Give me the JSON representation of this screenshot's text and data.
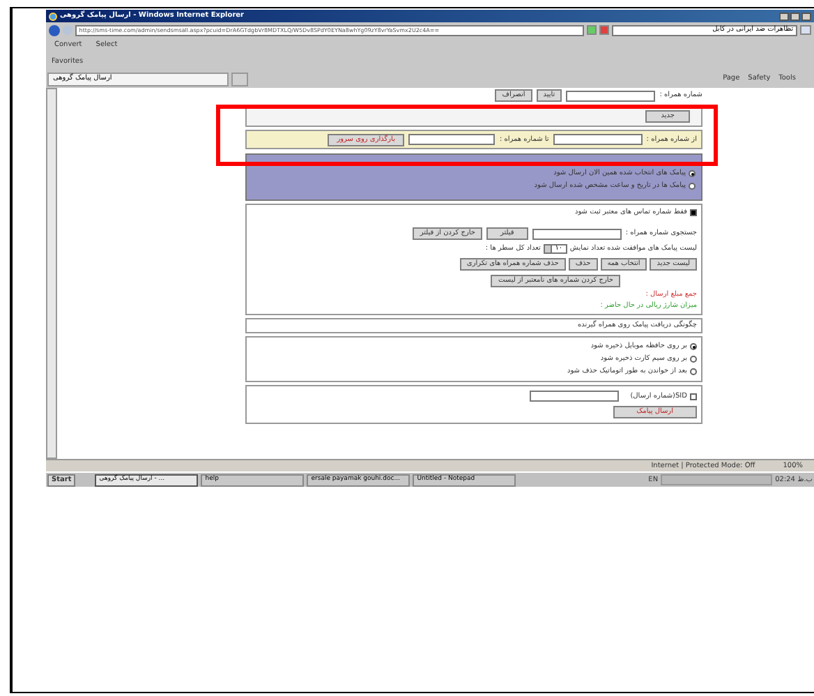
{
  "window": {
    "title": "ارسال پیامک گروهی - Windows Internet Explorer",
    "url": "http://sms-time.com/admin/sendsmsall.aspx?pcuid=DrA6GTdgbVr8MDTXLQ/W5Dv8SPdY0EYNa8whYg09zY8vrYaSvmx2U2c4A==",
    "search_text": "تظاهرات ضد ایرانی در کابل"
  },
  "toolbar": {
    "convert": "Convert",
    "select": "Select"
  },
  "favorites": "Favorites",
  "tab": {
    "label": "ارسال پیامک گروهی",
    "selected": true
  },
  "commands": {
    "page": "Page",
    "safety": "Safety",
    "tools": "Tools"
  },
  "form": {
    "mobile_label": "شماره همراه :",
    "confirm_button": "تایید",
    "cancel_button": "انصراف",
    "new_button": "جدید",
    "range": {
      "from_label": "از شماره همراه :",
      "to_label": "تا شماره همراه :",
      "upload_button": "بارگذاری روی سرور"
    },
    "send_time": [
      {
        "label": "پیامک های انتخاب شده همین الان ارسال شود",
        "selected": true
      },
      {
        "label": "پیامک ها در تاریخ و ساعت مشخص شده ارسال شود",
        "selected": false
      }
    ],
    "valid_only": {
      "label": "فقط شماره تماس های معتبر ثبت شود",
      "checked": true
    },
    "search_label": "جستجوی شماره همراه :",
    "filter_button": "فیلتر",
    "unfilter_button": "خارج کردن از فیلتر",
    "list_label": "لیست پیامک های موافقت شده تعداد نمایش",
    "page_size": "۱۰",
    "total_label": "تعداد کل سطر ها :",
    "list_buttons": [
      "لیست جدید",
      "انتخاب همه",
      "حذف",
      "حذف شماره همراه های تکراری"
    ],
    "remove_invalid_button": "خارج کردن شماره های نامعتبر از لیست",
    "total_cost": "جمع مبلغ ارسال :",
    "balance": "میزان شارژ ریالی در حال حاضر :",
    "receive_heading": "چگونگی دریافت پیامک روی همراه گیرنده",
    "receive_options": [
      {
        "label": "بر روی حافظه موبایل ذخیره شود",
        "selected": true
      },
      {
        "label": "بر روی سیم کارت ذخیره شود",
        "selected": false
      },
      {
        "label": "بعد از خواندن به طور اتوماتیک حذف شود",
        "selected": false
      }
    ],
    "sid": {
      "label": "SID(شماره ارسال)",
      "checked": false
    },
    "send_button": "ارسال پیامک"
  },
  "status_bar": {
    "zone": "Internet | Protected Mode: Off",
    "zoom": "100%"
  },
  "taskbar": {
    "start": "Start",
    "browser_item": {
      "label": "ارسال پیامک گروهی - ...",
      "selected": true
    },
    "help_item": {
      "label": "help",
      "selected": false
    },
    "document_item": {
      "label": "ersale payamak gouhi.doc...",
      "selected": false
    },
    "notepad_item": {
      "label": "Untitled - Notepad",
      "selected": false
    },
    "language": "EN",
    "clock": "02:24 ب.ظ"
  }
}
